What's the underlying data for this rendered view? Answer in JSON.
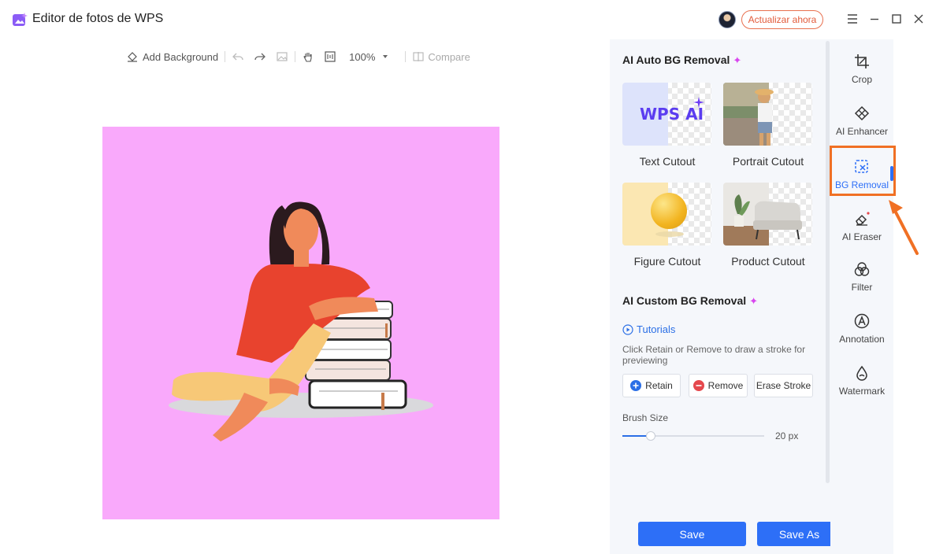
{
  "titlebar": {
    "app_title": "Editor de fotos de WPS",
    "upgrade_label": "Actualizar ahora"
  },
  "toolbar": {
    "add_background": "Add Background",
    "zoom": "100%",
    "compare": "Compare"
  },
  "panel": {
    "auto_title": "AI Auto BG Removal",
    "auto_sparkle": "✦",
    "cards": [
      {
        "label": "Text Cutout",
        "thumb_text": "WPS AI"
      },
      {
        "label": "Portrait Cutout"
      },
      {
        "label": "Figure Cutout"
      },
      {
        "label": "Product Cutout"
      }
    ],
    "custom_title": "AI Custom BG Removal",
    "custom_sparkle": "✦",
    "tutorials": "Tutorials",
    "hint": "Click Retain or Remove to draw a stroke for previewing",
    "retain": "Retain",
    "remove": "Remove",
    "erase_stroke": "Erase Stroke",
    "brush_label": "Brush Size",
    "brush_value": "20  px",
    "brush_level": 0.2
  },
  "actions": {
    "save": "Save",
    "save_as": "Save As"
  },
  "rail": [
    {
      "label": "Crop",
      "icon": "crop-icon"
    },
    {
      "label": "AI Enhancer",
      "icon": "ai-enhancer-icon"
    },
    {
      "label": "BG Removal",
      "icon": "bg-removal-icon",
      "active": true
    },
    {
      "label": "AI Eraser",
      "icon": "eraser-icon"
    },
    {
      "label": "Filter",
      "icon": "filter-icon"
    },
    {
      "label": "Annotation",
      "icon": "annotation-icon"
    },
    {
      "label": "Watermark",
      "icon": "watermark-icon"
    }
  ],
  "colors": {
    "accent": "#2d6ff7",
    "canvas_bg": "#f9a9fb",
    "highlight": "#f07024",
    "upgrade": "#e25a3a"
  }
}
